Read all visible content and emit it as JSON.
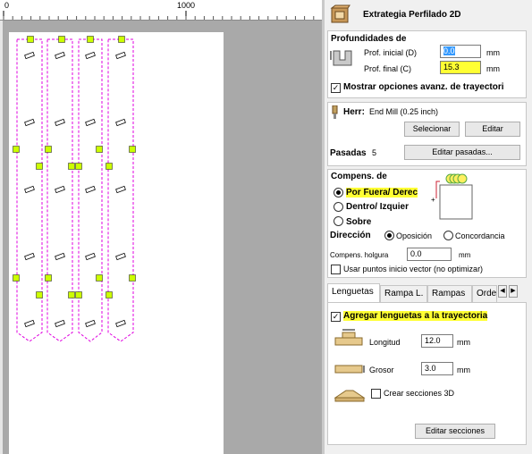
{
  "ruler": {
    "labels": [
      "0",
      "1000"
    ]
  },
  "panel": {
    "title": "Extrategia Perfilado 2D",
    "depths": {
      "heading": "Profundidades de",
      "start_label": "Prof. inicial (D)",
      "start_value": "0.0",
      "start_unit": "mm",
      "end_label": "Prof. final (C)",
      "end_value": "15.3",
      "end_unit": "mm",
      "advanced_label": "Mostrar opciones avanz. de trayectori",
      "advanced_checked": true
    },
    "tool": {
      "label": "Herr:",
      "name": "End Mill (0.25 inch)",
      "select_button": "Selecionar",
      "edit_button": "Editar",
      "passes_label": "Pasadas",
      "passes_value": "5",
      "edit_passes_button": "Editar pasadas..."
    },
    "compensation": {
      "heading": "Compens. de",
      "options": [
        "Por Fuera/ Derec",
        "Dentro/ Izquier",
        "Sobre"
      ],
      "selected": "Por Fuera/ Derec",
      "direction_label": "Dirección",
      "direction_options": [
        "Oposición",
        "Concordancia"
      ],
      "direction_selected": "Oposición",
      "allowance_label": "Compens. holgura",
      "allowance_value": "0.0",
      "allowance_unit": "mm",
      "use_start_points_label": "Usar puntos inicio vector (no optimizar)",
      "use_start_points_checked": false
    },
    "tabs": [
      "Lenguetas",
      "Rampa L.",
      "Rampas",
      "Orde"
    ],
    "active_tab": "Lenguetas",
    "tabs_panel": {
      "add_tabs_label": "Agregar lenguetas a la trayectoria",
      "add_tabs_checked": true,
      "length_label": "Longitud",
      "length_value": "12.0",
      "length_unit": "mm",
      "thickness_label": "Grosor",
      "thickness_value": "3.0",
      "thickness_unit": "mm",
      "sections3d_label": "Crear secciones 3D",
      "sections3d_checked": false,
      "edit_sections_button": "Editar secciones"
    }
  },
  "colors": {
    "toolpath": "#e000e0",
    "tab_marker": "#ccff00",
    "highlight": "#ffff33",
    "accent_blue": "#3399ff"
  },
  "icons": [
    "profile-strategy-icon",
    "depth-diagram-icon",
    "end-mill-icon",
    "offset-preview-icon",
    "tab-length-icon",
    "tab-thickness-icon",
    "3d-tab-icon"
  ]
}
